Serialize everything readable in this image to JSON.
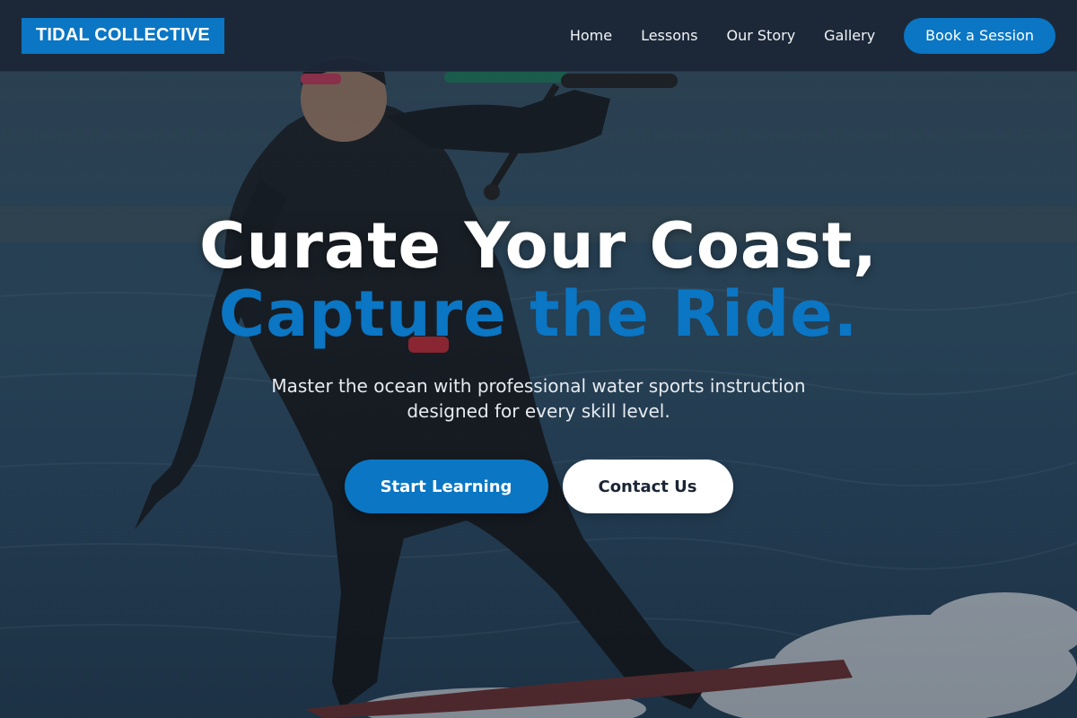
{
  "brand": {
    "logo_text": "TIDAL COLLECTIVE"
  },
  "nav": {
    "links": [
      "Home",
      "Lessons",
      "Our Story",
      "Gallery"
    ],
    "cta_label": "Book a Session"
  },
  "hero": {
    "headline_line1": "Curate Your Coast,",
    "headline_line2": "Capture the Ride.",
    "subtitle": "Master the ocean with professional water sports instruction designed for every skill level.",
    "primary_button": "Start Learning",
    "secondary_button": "Contact Us",
    "background_image": "kitesurfer-on-ocean-photo"
  },
  "colors": {
    "accent": "#0a76c4",
    "navbar_bg": "#1c2636",
    "text_on_dark": "#ffffff",
    "button_dark_text": "#1b2535"
  }
}
